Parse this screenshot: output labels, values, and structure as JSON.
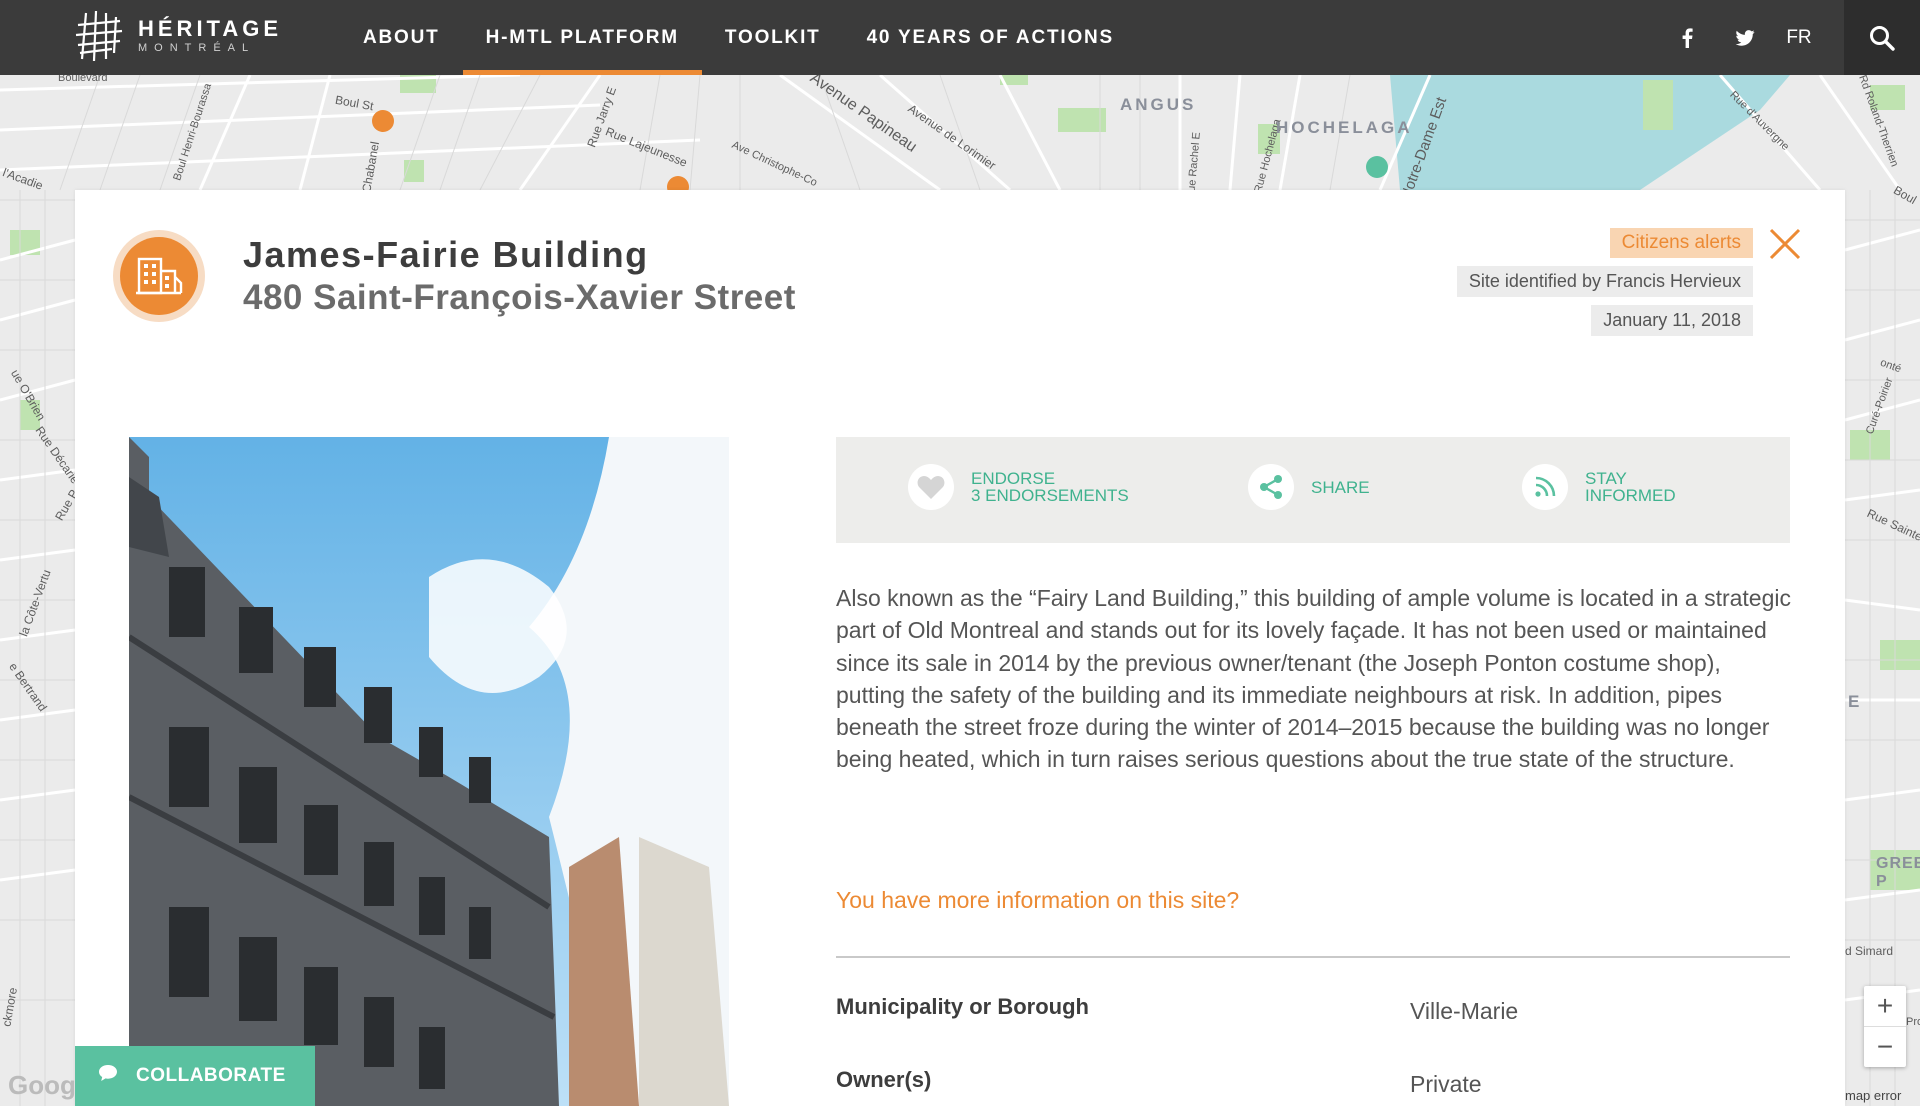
{
  "header": {
    "logo": {
      "line1": "HÉRITAGE",
      "line2": "MONTRÉAL"
    },
    "nav": [
      {
        "label": "ABOUT",
        "active": false
      },
      {
        "label": "H-MTL PLATFORM",
        "active": true
      },
      {
        "label": "TOOLKIT",
        "active": false
      },
      {
        "label": "40 YEARS OF ACTIONS",
        "active": false
      }
    ],
    "social": [
      "facebook-icon",
      "twitter-icon"
    ],
    "lang": "FR",
    "search_icon": "search-icon"
  },
  "map": {
    "streets": [
      "Boulevard",
      "Boul Henri-Bourassa",
      "Boul St",
      "Chabanel",
      "Rue Jarry E",
      "Rue Lajeunesse",
      "Avenue Papineau",
      "Ave Christophe-Co",
      "Avenue de Lorimier",
      "Rue Rachel E",
      "Rue Hochelaga",
      "Notre-Dame Est",
      "Rue d'Auvergne",
      "Rd Roland-Therrien",
      "l'Acadie",
      "ue O'Brien",
      "Rue Décarie",
      "Rue P",
      "la Côte-Vertu",
      "e Bertrand",
      "ckmore",
      "Boul",
      "onté",
      "Curé-Poirier",
      "Rue Sainte",
      "d Simard",
      "Pro"
    ],
    "districts": [
      "ANGUS",
      "HOCHELAGA",
      "E",
      "GREE P"
    ],
    "attribution": "Goog",
    "map_error": "map error"
  },
  "site": {
    "title": "James-Fairie Building",
    "address": "480 Saint-François-Xavier Street",
    "icon": "building-icon",
    "alert_badge": "Citizens alerts",
    "identified_by": "Site identified by Francis Hervieux",
    "date": "January 11, 2018",
    "actions": {
      "endorse_line1": "ENDORSE",
      "endorse_line2": "3 ENDORSEMENTS",
      "share": "SHARE",
      "stay_line1": "STAY",
      "stay_line2": "INFORMED"
    },
    "description": "Also known as the “Fairy Land Building,” this building of ample volume is located in a strategic part of Old Montreal and stands out for its lovely façade. It has not been used or maintained since its sale in 2014 by the previous owner/tenant (the Joseph Ponton costume shop), putting the safety of the building and its immediate neighbours at risk. In addition, pipes beneath the street froze during the winter of 2014–2015 because the building was no longer being heated, which in turn raises serious questions about the true state of the structure.",
    "more_info": "You have more information on this site?",
    "details": [
      {
        "label": "Municipality or Borough",
        "value": "Ville-Marie"
      },
      {
        "label": "Owner(s)",
        "value": "Private"
      }
    ]
  },
  "collaborate": "COLLABORATE",
  "colors": {
    "accent": "#ec8a34",
    "green": "#5ac1a0",
    "header": "#3b3b3b"
  }
}
